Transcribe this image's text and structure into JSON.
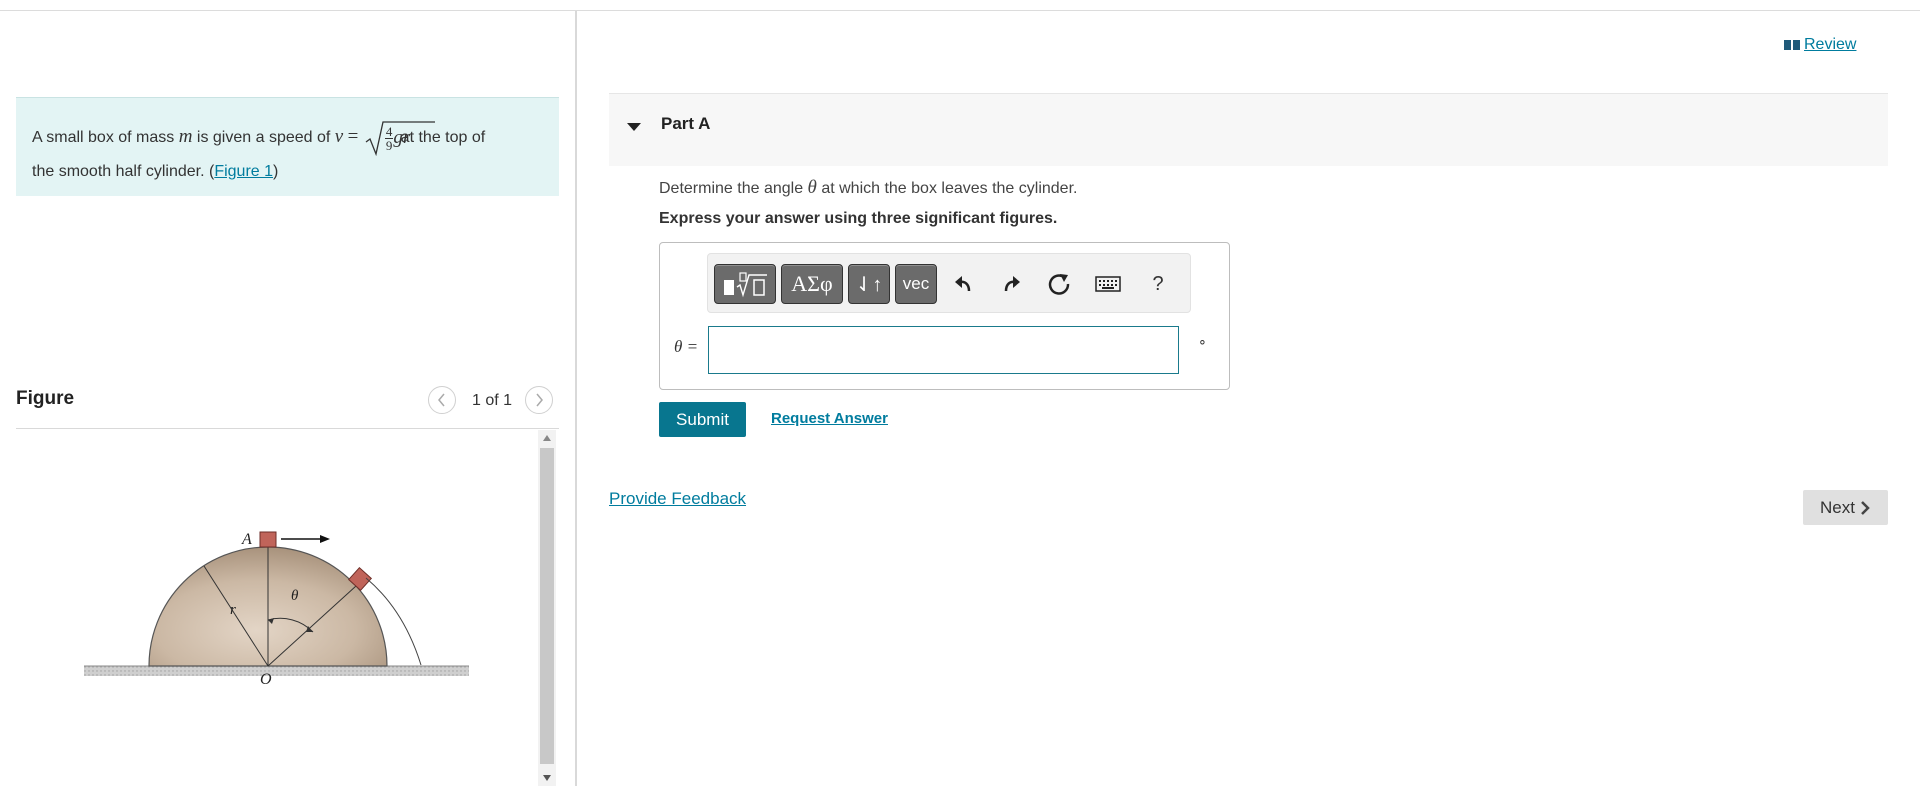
{
  "problem": {
    "text_before": "A small box of mass ",
    "mass_symbol": "m",
    "text_mid": " is given a speed of ",
    "speed_lhs": "v",
    "equals": "=",
    "frac_num": "4",
    "frac_den": "9",
    "radicand_tail": "gr",
    "text_after": " at the top of",
    "line2_text": "the smooth half cylinder. (",
    "figure_link": "Figure 1",
    "close_paren": ")"
  },
  "figure": {
    "title": "Figure",
    "pager": "1 of 1",
    "label_A": "A",
    "label_r": "r",
    "label_theta": "θ",
    "label_O": "O",
    "colors": {
      "cylinder": "#cbb8a4",
      "box": "#c0645a",
      "ground": "#c8c8c8"
    }
  },
  "header": {
    "review_label": "Review"
  },
  "part": {
    "title": "Part A"
  },
  "question": {
    "text_before": "Determine the angle ",
    "symbol": "θ",
    "text_after": " at which the box leaves the cylinder.",
    "instruction": "Express your answer using three significant figures."
  },
  "toolbar": {
    "templates": "templates",
    "greek": "ΑΣφ",
    "arrows": "⇃↑",
    "vec": "vec",
    "help": "?",
    "icons": [
      "undo-icon",
      "redo-icon",
      "reset-icon",
      "keyboard-icon"
    ]
  },
  "answer": {
    "label": "θ =",
    "value": "",
    "placeholder": "",
    "unit": "∘"
  },
  "actions": {
    "submit": "Submit",
    "request": "Request Answer",
    "feedback": "Provide Feedback",
    "next": "Next"
  },
  "colors": {
    "accent": "#007c9e",
    "submit_bg": "#08768f",
    "problem_bg": "#e3f4f4"
  }
}
